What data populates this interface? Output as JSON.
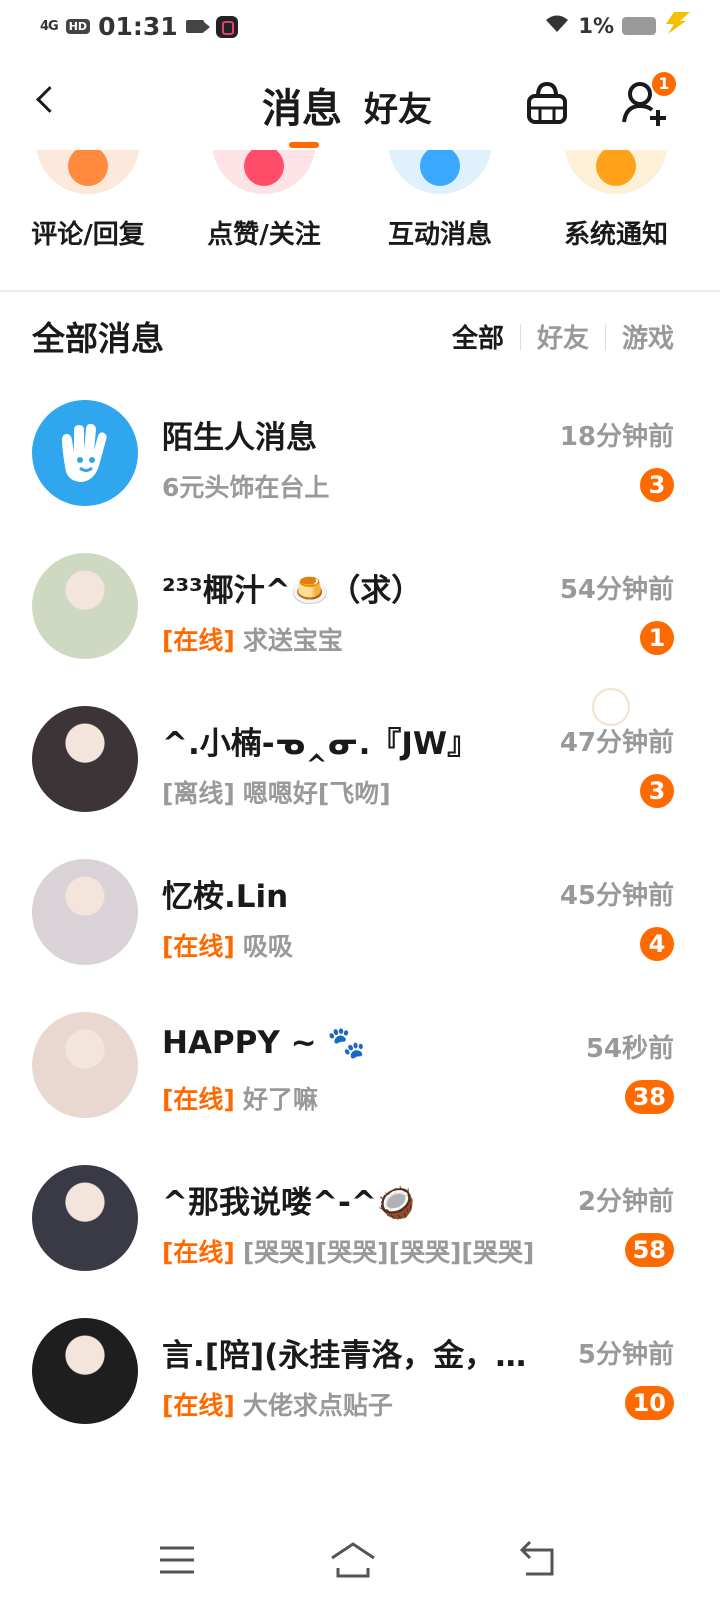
{
  "status_bar": {
    "signal": "4G",
    "hd": "HD",
    "time": "01:31",
    "battery": "1%"
  },
  "header": {
    "tab_messages": "消息",
    "tab_friends": "好友",
    "add_friend_badge": "1"
  },
  "categories": [
    {
      "label": "评论/回复",
      "color": "#ff8a3d",
      "bg": "#fde9dc"
    },
    {
      "label": "点赞/关注",
      "color": "#ff4d6a",
      "bg": "#fde3e6"
    },
    {
      "label": "互动消息",
      "color": "#3aa8ff",
      "bg": "#dff1fd"
    },
    {
      "label": "系统通知",
      "color": "#ffa21a",
      "bg": "#fdf0d6"
    }
  ],
  "section": {
    "title": "全部消息",
    "filters": [
      "全部",
      "好友",
      "游戏"
    ]
  },
  "messages": [
    {
      "name": "陌生人消息",
      "status": "",
      "preview": "6元头饰在台上",
      "time": "18分钟前",
      "badge": "3",
      "avatar": "stranger"
    },
    {
      "name": "²³³椰汁^🍮（求）",
      "status": "[在线]",
      "preview": "求送宝宝",
      "time": "54分钟前",
      "badge": "1",
      "avatar": "photo"
    },
    {
      "name": "^.小楠-ᓀ‸ᓂ.『JW』",
      "status": "[离线]",
      "preview": "嗯嗯好[飞吻]",
      "time": "47分钟前",
      "badge": "3",
      "avatar": "photo",
      "offline": true
    },
    {
      "name": "忆桉.Lin",
      "status": "[在线]",
      "preview": "吸吸",
      "time": "45分钟前",
      "badge": "4",
      "avatar": "photo"
    },
    {
      "name": "HAPPY ~ 🐾",
      "status": "[在线]",
      "preview": "好了嘛",
      "time": "54秒前",
      "badge": "38",
      "avatar": "photo"
    },
    {
      "name": "^那我说喽^-^🥥",
      "status": "[在线]",
      "preview": "[哭哭][哭哭][哭哭][哭哭]",
      "time": "2分钟前",
      "badge": "58",
      "avatar": "photo"
    },
    {
      "name": "言.[陪](永挂青洛，金，…",
      "status": "[在线]",
      "preview": "大佬求点贴子",
      "time": "5分钟前",
      "badge": "10",
      "avatar": "photo"
    }
  ]
}
